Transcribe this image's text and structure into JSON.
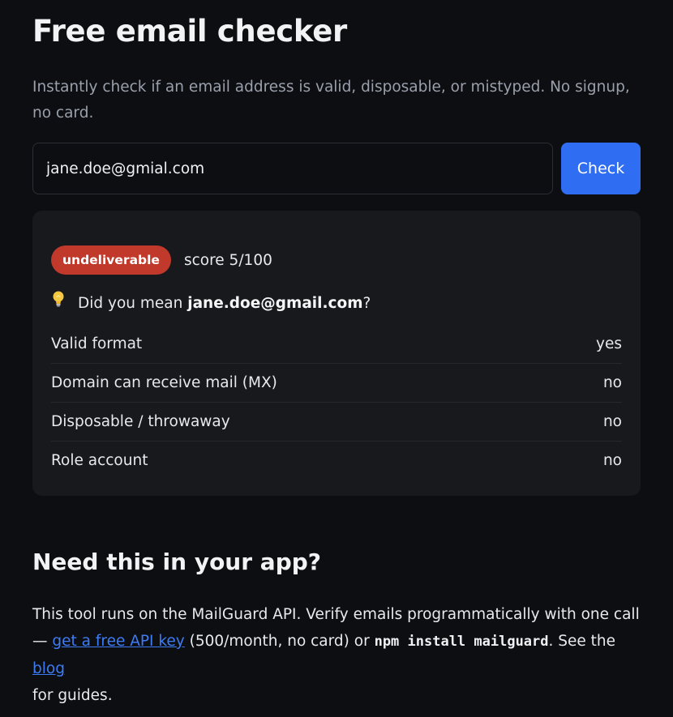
{
  "header": {
    "title": "Free email checker",
    "subtitle": "Instantly check if an email address is valid, disposable, or mistyped. No signup, no card."
  },
  "form": {
    "email_value": "jane.doe@gmial.com",
    "check_label": "Check"
  },
  "result": {
    "status_badge": "undeliverable",
    "status_color": "#c0392b",
    "score_text": "score 5/100",
    "suggestion_icon": "lightbulb-icon",
    "suggestion_prefix": "Did you mean ",
    "suggestion_email": "jane.doe@gmail.com",
    "suggestion_suffix": "?",
    "checks": [
      {
        "label": "Valid format",
        "value": "yes"
      },
      {
        "label": "Domain can receive mail (MX)",
        "value": "no"
      },
      {
        "label": "Disposable / throwaway",
        "value": "no"
      },
      {
        "label": "Role account",
        "value": "no"
      }
    ]
  },
  "api_section": {
    "heading": "Need this in your app?",
    "text_1": "This tool runs on the MailGuard API. Verify emails programmatically with one call — ",
    "link_api_key": "get a free API key",
    "text_2": " (500/month, no card) or ",
    "code_install": "npm install mailguard",
    "text_3": ". See the ",
    "link_blog": "blog",
    "text_4": " for guides."
  },
  "colors": {
    "accent": "#2f6df3",
    "link": "#3d7cf5",
    "background": "#0d0e11",
    "card": "#18191d"
  }
}
